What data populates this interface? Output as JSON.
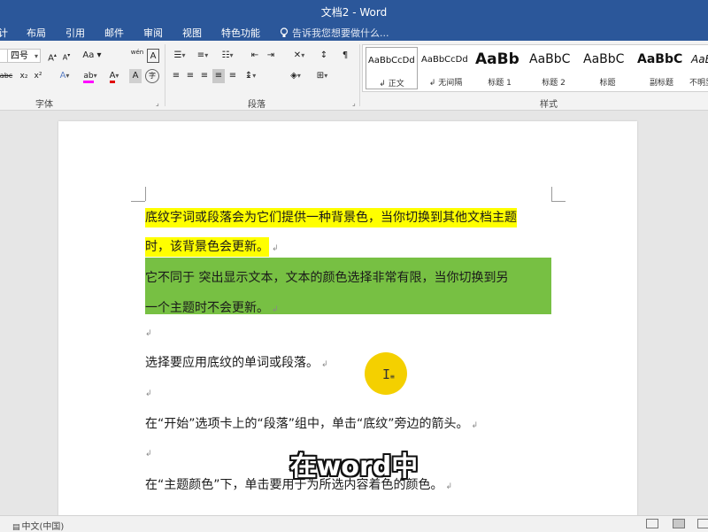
{
  "window": {
    "title": "文档2 - Word"
  },
  "tabs": [
    {
      "id": "design",
      "label": "计"
    },
    {
      "id": "layout",
      "label": "布局"
    },
    {
      "id": "references",
      "label": "引用"
    },
    {
      "id": "mailings",
      "label": "邮件"
    },
    {
      "id": "review",
      "label": "审阅"
    },
    {
      "id": "view",
      "label": "视图"
    },
    {
      "id": "special",
      "label": "特色功能"
    }
  ],
  "tell_me": {
    "placeholder": "告诉我您想要做什么..."
  },
  "ribbon": {
    "font": {
      "size_value": "四号",
      "group_label": "字体",
      "grow_label": "A",
      "shrink_label": "A",
      "case_label": "Aa",
      "phonetic_label": "wén",
      "border_label": "A",
      "strike_label": "abc",
      "subscript_label": "x₂",
      "superscript_label": "x²",
      "effects_label": "A",
      "highlight_label": "ab",
      "color_label": "A",
      "shading_label": "A",
      "enclose_label": "字"
    },
    "paragraph": {
      "group_label": "段落"
    },
    "styles": {
      "group_label": "样式",
      "items": [
        {
          "sample": "AaBbCcDd",
          "name": "↲ 正文",
          "selected": true
        },
        {
          "sample": "AaBbCcDd",
          "name": "↲ 无间隔",
          "selected": false
        },
        {
          "sample": "AaBb",
          "name": "标题 1",
          "selected": false
        },
        {
          "sample": "AaBbC",
          "name": "标题 2",
          "selected": false
        },
        {
          "sample": "AaBbC",
          "name": "标题",
          "selected": false
        },
        {
          "sample": "AaBbC",
          "name": "副标题",
          "selected": false
        },
        {
          "sample": "AaBb",
          "name": "不明显",
          "selected": false
        }
      ]
    }
  },
  "document": {
    "p1_line1": "底纹字词或段落会为它们提供一种背景色，当你切换到其他文档主题",
    "p1_line2": "时，该背景色会更新。",
    "p2_line1": "它不同于 突出显示文本，文本的颜色选择非常有限，当你切换到另",
    "p2_line2": "一个主题时不会更新。",
    "p3": "选择要应用底纹的单词或段落。",
    "p4": "在“开始”选项卡上的“段落”组中，单击“底纹”旁边的箭头。",
    "p5": "在“主题颜色”下，单击要用于为所选内容着色的颜色。",
    "paragraph_mark": "↲"
  },
  "subtitle": "在word中",
  "status": {
    "language": "中文(中国)"
  },
  "colors": {
    "title_bar": "#2b579a",
    "highlight_yellow": "#ffff00",
    "shading_green": "#77c043",
    "cursor_marker": "#f4d000"
  }
}
